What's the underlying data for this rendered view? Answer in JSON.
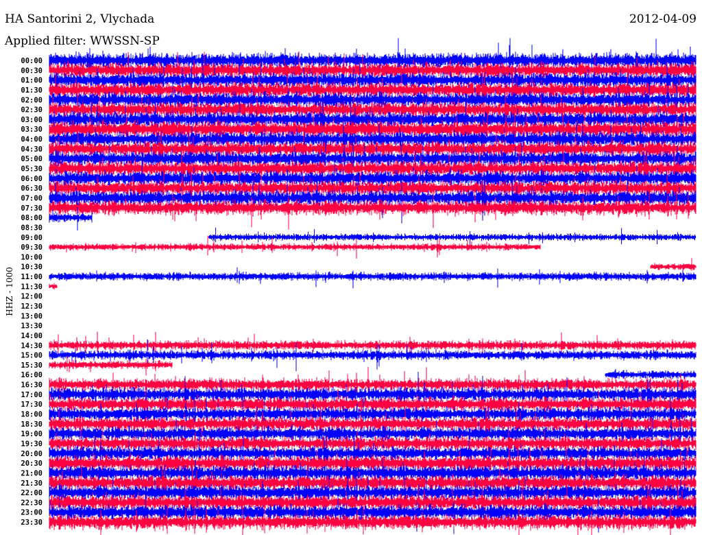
{
  "header": {
    "station": "HA Santorini 2, Vlychada",
    "filter": "Applied filter: WWSSN-SP",
    "date": "2012-04-09"
  },
  "chart_data": {
    "type": "line",
    "title": "HA Santorini 2, Vlychada",
    "subtitle": "Applied filter: WWSSN-SP",
    "ylabel": "HHZ - 1000",
    "xlabel": "",
    "x_range_minutes": [
      0,
      30
    ],
    "colors": {
      "even": "#0000ff",
      "odd": "#ff0040"
    },
    "rows": [
      {
        "label": "00:00",
        "segments": [
          [
            0,
            30
          ]
        ],
        "noise_level": 11
      },
      {
        "label": "00:30",
        "segments": [
          [
            0,
            30
          ]
        ],
        "noise_level": 11
      },
      {
        "label": "01:00",
        "segments": [
          [
            0,
            30
          ]
        ],
        "noise_level": 11
      },
      {
        "label": "01:30",
        "segments": [
          [
            0,
            30
          ]
        ],
        "noise_level": 11
      },
      {
        "label": "02:00",
        "segments": [
          [
            0,
            30
          ]
        ],
        "noise_level": 11
      },
      {
        "label": "02:30",
        "segments": [
          [
            0,
            30
          ]
        ],
        "noise_level": 11
      },
      {
        "label": "03:00",
        "segments": [
          [
            0,
            30
          ]
        ],
        "noise_level": 11
      },
      {
        "label": "03:30",
        "segments": [
          [
            0,
            30
          ]
        ],
        "noise_level": 12
      },
      {
        "label": "04:00",
        "segments": [
          [
            0,
            30
          ]
        ],
        "noise_level": 11
      },
      {
        "label": "04:30",
        "segments": [
          [
            0,
            30
          ]
        ],
        "noise_level": 11
      },
      {
        "label": "05:00",
        "segments": [
          [
            0,
            30
          ]
        ],
        "noise_level": 11
      },
      {
        "label": "05:30",
        "segments": [
          [
            0,
            30
          ]
        ],
        "noise_level": 11
      },
      {
        "label": "06:00",
        "segments": [
          [
            0,
            30
          ]
        ],
        "noise_level": 11
      },
      {
        "label": "06:30",
        "segments": [
          [
            0,
            30
          ]
        ],
        "noise_level": 11
      },
      {
        "label": "07:00",
        "segments": [
          [
            0,
            30
          ]
        ],
        "noise_level": 11
      },
      {
        "label": "07:30",
        "segments": [
          [
            0,
            30
          ]
        ],
        "noise_level": 11
      },
      {
        "label": "08:00",
        "segments": [
          [
            0,
            2.0
          ]
        ],
        "noise_level": 7
      },
      {
        "label": "08:30",
        "segments": [],
        "noise_level": 0
      },
      {
        "label": "09:00",
        "segments": [
          [
            7.4,
            30
          ]
        ],
        "noise_level": 5
      },
      {
        "label": "09:30",
        "segments": [
          [
            0,
            22.8
          ]
        ],
        "noise_level": 5
      },
      {
        "label": "10:00",
        "segments": [],
        "noise_level": 0
      },
      {
        "label": "10:30",
        "segments": [
          [
            27.9,
            30
          ]
        ],
        "noise_level": 5
      },
      {
        "label": "11:00",
        "segments": [
          [
            0,
            30
          ]
        ],
        "noise_level": 6
      },
      {
        "label": "11:30",
        "segments": [
          [
            0,
            0.35
          ]
        ],
        "noise_level": 4
      },
      {
        "label": "12:00",
        "segments": [],
        "noise_level": 0
      },
      {
        "label": "12:30",
        "segments": [],
        "noise_level": 0
      },
      {
        "label": "13:00",
        "segments": [],
        "noise_level": 0
      },
      {
        "label": "13:30",
        "segments": [],
        "noise_level": 0
      },
      {
        "label": "14:00",
        "segments": [],
        "noise_level": 0
      },
      {
        "label": "14:30",
        "segments": [
          [
            0,
            30
          ]
        ],
        "noise_level": 7
      },
      {
        "label": "15:00",
        "segments": [
          [
            0,
            30
          ]
        ],
        "noise_level": 7
      },
      {
        "label": "15:30",
        "segments": [
          [
            0,
            5.7
          ]
        ],
        "noise_level": 6
      },
      {
        "label": "16:00",
        "segments": [
          [
            25.8,
            30
          ]
        ],
        "noise_level": 6
      },
      {
        "label": "16:30",
        "segments": [
          [
            0,
            30
          ]
        ],
        "noise_level": 9
      },
      {
        "label": "17:00",
        "segments": [
          [
            0,
            30
          ]
        ],
        "noise_level": 10
      },
      {
        "label": "17:30",
        "segments": [
          [
            0,
            30
          ]
        ],
        "noise_level": 10
      },
      {
        "label": "18:00",
        "segments": [
          [
            0,
            30
          ]
        ],
        "noise_level": 10
      },
      {
        "label": "18:30",
        "segments": [
          [
            0,
            30
          ]
        ],
        "noise_level": 10
      },
      {
        "label": "19:00",
        "segments": [
          [
            0,
            30
          ]
        ],
        "noise_level": 10
      },
      {
        "label": "19:30",
        "segments": [
          [
            0,
            30
          ]
        ],
        "noise_level": 10
      },
      {
        "label": "20:00",
        "segments": [
          [
            0,
            30
          ]
        ],
        "noise_level": 10
      },
      {
        "label": "20:30",
        "segments": [
          [
            0,
            30
          ]
        ],
        "noise_level": 11
      },
      {
        "label": "21:00",
        "segments": [
          [
            0,
            30
          ]
        ],
        "noise_level": 11
      },
      {
        "label": "21:30",
        "segments": [
          [
            0,
            30
          ]
        ],
        "noise_level": 11
      },
      {
        "label": "22:00",
        "segments": [
          [
            0,
            30
          ]
        ],
        "noise_level": 11
      },
      {
        "label": "22:30",
        "segments": [
          [
            0,
            30
          ]
        ],
        "noise_level": 11
      },
      {
        "label": "23:00",
        "segments": [
          [
            0,
            30
          ]
        ],
        "noise_level": 11
      },
      {
        "label": "23:30",
        "segments": [
          [
            0,
            30
          ]
        ],
        "noise_level": 11
      }
    ]
  }
}
